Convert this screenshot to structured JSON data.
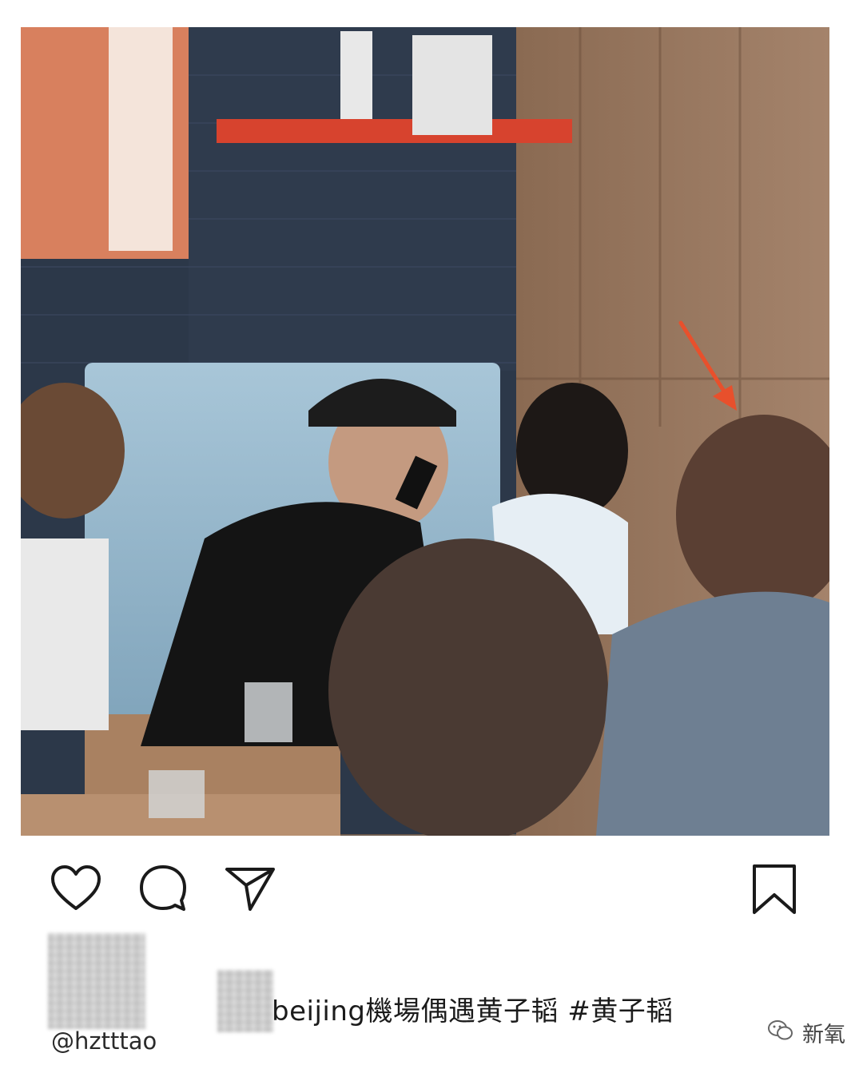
{
  "post": {
    "photo_alt": "photo",
    "caption": "beijing機場偶遇黄子韬 #黄子韬",
    "username": "@hztttao"
  },
  "actions": {
    "like_icon": "heart-outline",
    "comment_icon": "speech-bubble-outline",
    "share_icon": "paper-plane-outline",
    "save_icon": "bookmark-outline"
  },
  "watermark": {
    "logo_icon": "wechat-logo",
    "label": "新氧"
  },
  "colors": {
    "arrow": "#e8502c",
    "icon_stroke": "#1a1a1a"
  }
}
